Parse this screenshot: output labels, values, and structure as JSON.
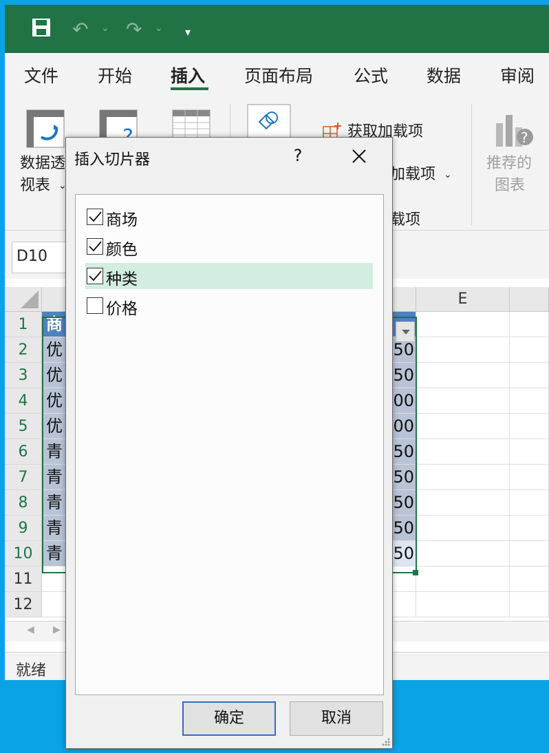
{
  "app": {
    "tabs": [
      "文件",
      "开始",
      "插入",
      "页面布局",
      "公式",
      "数据",
      "审阅"
    ],
    "active_tab": "插入"
  },
  "ribbon": {
    "pivot_table_line1": "数据透",
    "pivot_table_line2": "视表",
    "get_addins": "获取加载项",
    "my_addins": "加载项",
    "addins_group": "载项",
    "recommended_line1": "推荐的",
    "recommended_line2": "图表"
  },
  "formula_bar": {
    "name_box": "D10"
  },
  "sheet": {
    "col_e": "E",
    "rows": [
      "1",
      "2",
      "3",
      "4",
      "5",
      "6",
      "7",
      "8",
      "9",
      "10",
      "11",
      "12"
    ],
    "col_a": [
      "商",
      "优",
      "优",
      "优",
      "优",
      "青",
      "青",
      "青",
      "青",
      "青"
    ],
    "col_d": [
      "",
      "50",
      "50",
      "00",
      "00",
      "50",
      "50",
      "50",
      "50",
      "50"
    ]
  },
  "status": {
    "text": "就绪"
  },
  "dialog": {
    "title": "插入切片器",
    "help": "?",
    "items": [
      {
        "label": "商场",
        "checked": true
      },
      {
        "label": "颜色",
        "checked": true
      },
      {
        "label": "种类",
        "checked": true,
        "highlighted": true
      },
      {
        "label": "价格",
        "checked": false
      }
    ],
    "ok": "确定",
    "cancel": "取消"
  },
  "colors": {
    "title_bar": "#217346",
    "table_header": "#4f81bd",
    "table_band": "#b8c4d6",
    "highlight": "#d3eee0"
  }
}
